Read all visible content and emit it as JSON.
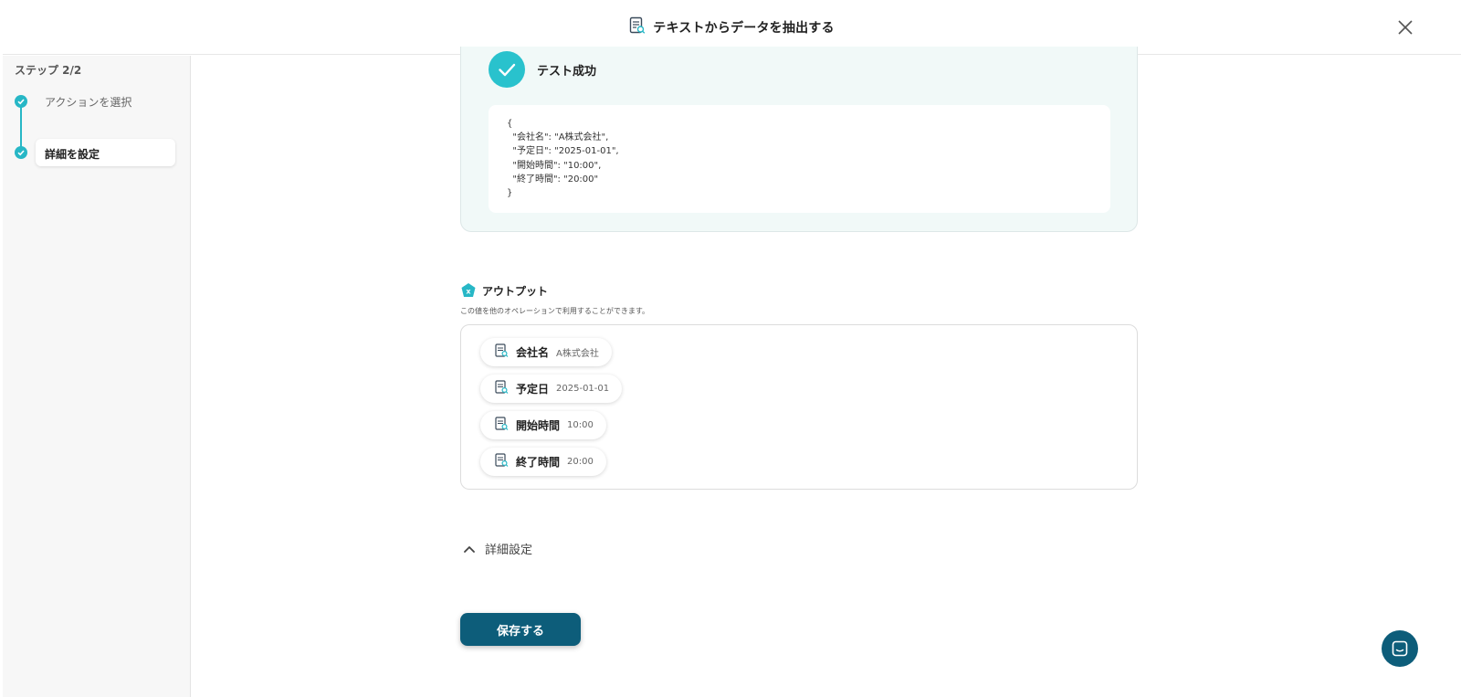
{
  "header": {
    "title": "テキストからデータを抽出する"
  },
  "sidebar": {
    "step_count": "ステップ 2/2",
    "steps": [
      {
        "label": "アクションを選択"
      },
      {
        "label": "詳細を設定"
      }
    ]
  },
  "test": {
    "title": "テスト成功",
    "json": "{\n  \"会社名\": \"A株式会社\",\n  \"予定日\": \"2025-01-01\",\n  \"開始時間\": \"10:00\",\n  \"終了時間\": \"20:00\"\n}"
  },
  "output": {
    "title": "アウトプット",
    "description": "この値を他のオペレーションで利用することができます。",
    "items": [
      {
        "key": "会社名",
        "value": "A株式会社"
      },
      {
        "key": "予定日",
        "value": "2025-01-01"
      },
      {
        "key": "開始時間",
        "value": "10:00"
      },
      {
        "key": "終了時間",
        "value": "20:00"
      }
    ]
  },
  "advanced": {
    "label": "詳細設定"
  },
  "actions": {
    "save_label": "保存する"
  },
  "colors": {
    "accent": "#27b7c6",
    "primary": "#0d5d7a"
  }
}
